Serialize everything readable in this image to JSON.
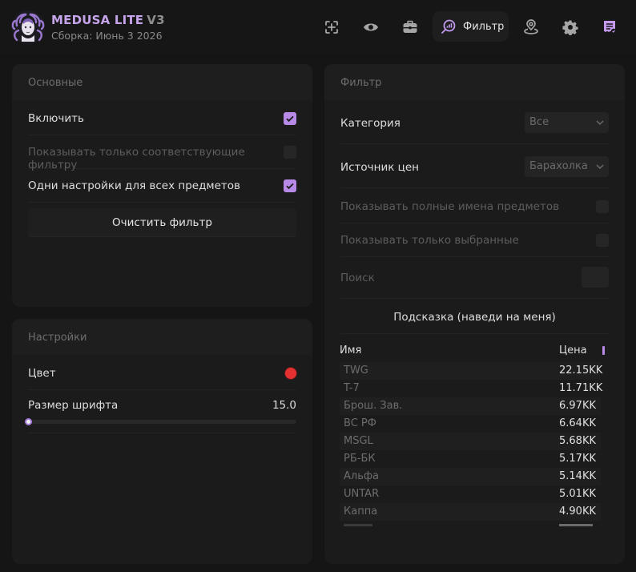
{
  "header": {
    "app_name": "MEDUSA LITE",
    "version": "V3",
    "subtitle": "Сборка: Июнь 3 2026",
    "nav": [
      {
        "icon": "crosshair-icon"
      },
      {
        "icon": "eye-icon"
      },
      {
        "icon": "briefcase-icon"
      },
      {
        "icon": "search-chart-icon",
        "label": "Фильтр",
        "active": true
      },
      {
        "icon": "map-pin-icon"
      },
      {
        "icon": "gear-icon"
      },
      {
        "icon": "receipt-icon"
      }
    ],
    "accent": "#b78ae8"
  },
  "basic": {
    "title": "Основные",
    "enable_label": "Включить",
    "enable_checked": true,
    "only_matching_label": "Показывать только соответствующие фильтру",
    "only_matching_checked": false,
    "same_settings_label": "Одни настройки для всех предметов",
    "same_settings_checked": true,
    "clear_button": "Очистить фильтр"
  },
  "settings": {
    "title": "Настройки",
    "color_label": "Цвет",
    "color_value": "#e63131",
    "font_size_label": "Размер шрифта",
    "font_size_value": "15.0",
    "font_size_fraction": 0.0
  },
  "filter": {
    "title": "Фильтр",
    "category_label": "Категория",
    "category_value": "Все",
    "price_source_label": "Источник цен",
    "price_source_value": "Барахолка",
    "full_names_label": "Показывать полные имена предметов",
    "only_selected_label": "Показывать только выбранные",
    "search_label": "Поиск",
    "hint_label": "Подсказка (наведи на меня)",
    "table": {
      "columns": [
        "Имя",
        "Цена"
      ],
      "rows": [
        {
          "name": "TWG",
          "price": "22.15KK"
        },
        {
          "name": "T-7",
          "price": "11.71KK"
        },
        {
          "name": "Брош. Зав.",
          "price": "6.97KK"
        },
        {
          "name": "BC РФ",
          "price": "6.64KK"
        },
        {
          "name": "MSGL",
          "price": "5.68KK"
        },
        {
          "name": "РБ-БК",
          "price": "5.17KK"
        },
        {
          "name": "Альфа",
          "price": "5.14KK"
        },
        {
          "name": "UNTAR",
          "price": "5.01KK"
        },
        {
          "name": "Каппа",
          "price": "4.90KK"
        }
      ]
    }
  }
}
